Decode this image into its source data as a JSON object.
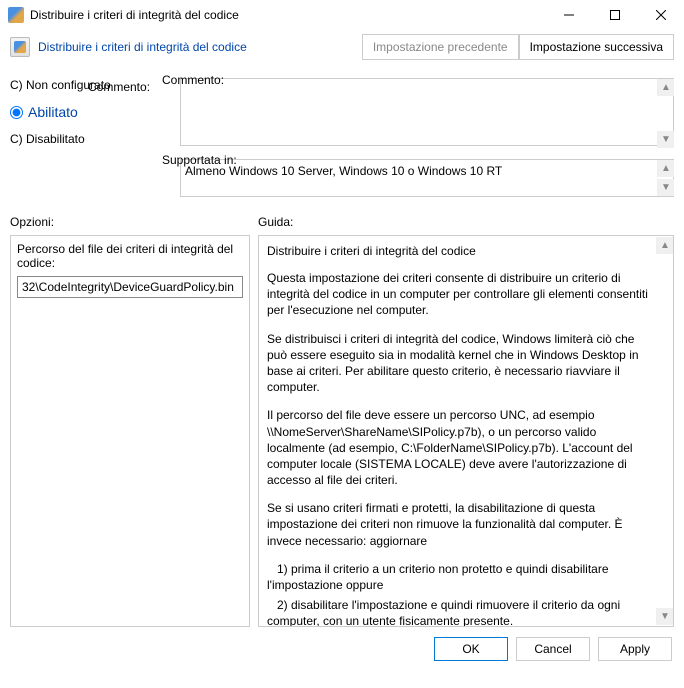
{
  "titlebar": {
    "title": "Distribuire i criteri di integrità del codice"
  },
  "subheader": {
    "title": "Distribuire i criteri di integrità del codice"
  },
  "nav": {
    "prev": "Impostazione precedente",
    "next": "Impostazione successiva"
  },
  "radios": {
    "not_configured": "C) Non configurato",
    "enabled": "Abilitato",
    "disabled": "C) Disabilitato"
  },
  "fields": {
    "comment_label": "Commento:",
    "comment_value": "",
    "supported_label": "Supportata in:",
    "supported_value": "Almeno Windows 10 Server, Windows 10 o Windows 10 RT"
  },
  "sections": {
    "options": "Opzioni:",
    "guide": "Guida:"
  },
  "options": {
    "path_label": "Percorso del file dei criteri di integrità del codice:",
    "path_value": "32\\CodeIntegrity\\DeviceGuardPolicy.bin"
  },
  "help": {
    "title": "Distribuire i criteri di integrità del codice",
    "p1": "Questa impostazione dei criteri consente di distribuire un criterio di integrità del codice in un computer per controllare gli elementi consentiti per l'esecuzione nel computer.",
    "p2": "Se distribuisci i criteri di integrità del codice, Windows limiterà ciò che può essere eseguito sia in modalità kernel che in Windows Desktop in base ai criteri. Per abilitare questo criterio, è necessario riavviare il computer.",
    "p3": "Il percorso del file deve essere un percorso UNC, ad esempio \\\\NomeServer\\ShareName\\SIPolicy.p7b), o un percorso valido localmente (ad esempio, C:\\FolderName\\SIPolicy.p7b).  L'account del computer locale (SISTEMA LOCALE) deve avere l'autorizzazione di accesso al file dei criteri.",
    "p4": "Se si usano criteri firmati e protetti, la disabilitazione di questa impostazione dei criteri non rimuove la funzionalità dal computer. È invece necessario: aggiornare",
    "p5a": "1) prima il criterio a un criterio non protetto e quindi disabilitare l'impostazione oppure",
    "p5b": "2) disabilitare l'impostazione e quindi rimuovere il criterio da ogni computer, con un utente fisicamente presente."
  },
  "footer": {
    "ok": "OK",
    "cancel": "Cancel",
    "apply": "Apply"
  }
}
